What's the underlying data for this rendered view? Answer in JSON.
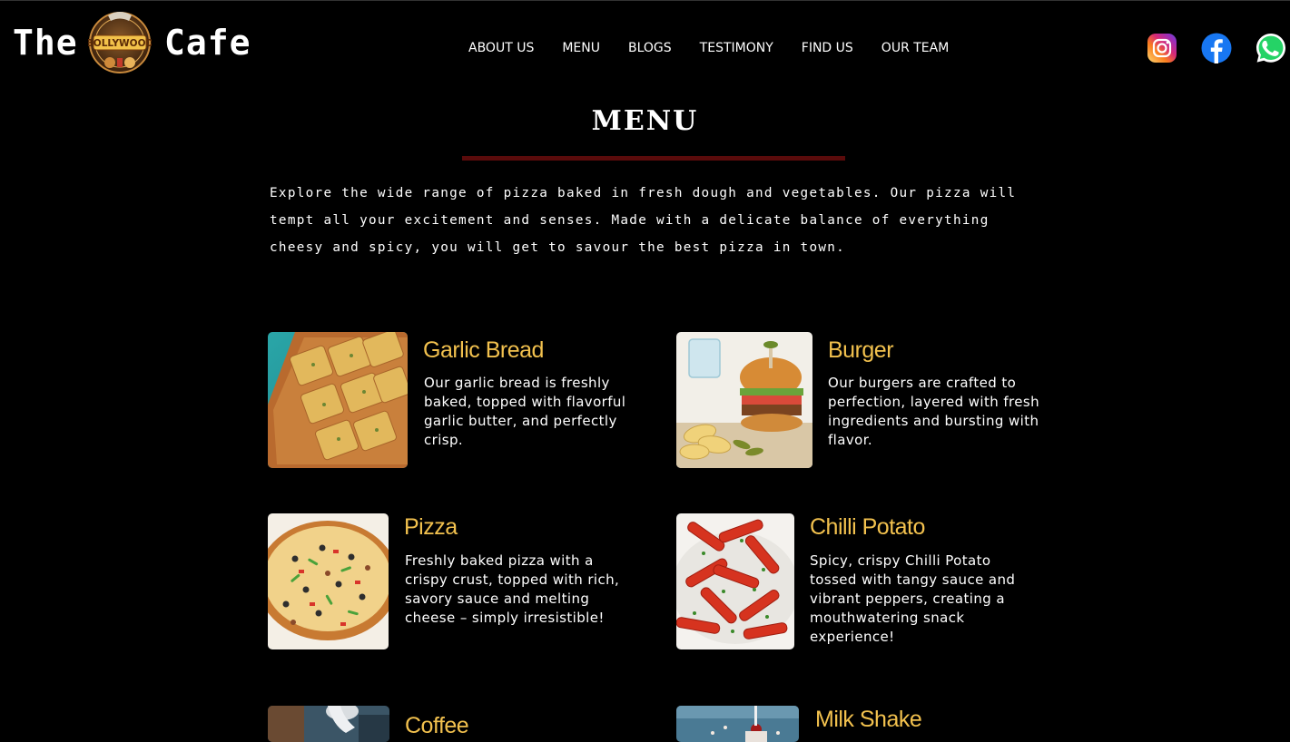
{
  "header": {
    "brand_left": "The",
    "brand_right": "Cafe",
    "logo_text": "BOLLYWOOD",
    "nav": [
      "ABOUT US",
      "MENU",
      "BLOGS",
      "TESTIMONY",
      "FIND US",
      "OUR TEAM"
    ],
    "social": [
      "instagram-icon",
      "facebook-icon",
      "whatsapp-icon"
    ]
  },
  "menu_section": {
    "title": "MENU",
    "intro": "Explore the wide range of pizza baked in fresh dough and vegetables. Our pizza will tempt all your excitement and senses. Made with a delicate balance of everything cheesy and spicy, you will get to savour the best pizza in town."
  },
  "items": [
    {
      "name": "Garlic Bread",
      "desc": "Our garlic bread is freshly baked, topped with flavorful garlic butter, and perfectly crisp."
    },
    {
      "name": "Burger",
      "desc": "Our burgers are crafted to perfection, layered with fresh ingredients and bursting with flavor."
    },
    {
      "name": "Pizza",
      "desc": "Freshly baked pizza with a crispy crust, topped with rich, savory sauce and melting cheese – simply irresistible!"
    },
    {
      "name": "Chilli Potato",
      "desc": "Spicy, crispy Chilli Potato tossed with tangy sauce and vibrant peppers, creating a mouthwatering snack experience!"
    },
    {
      "name": "Coffee",
      "desc": ""
    },
    {
      "name": "Milk Shake",
      "desc": ""
    }
  ],
  "colors": {
    "background": "#000000",
    "item_title": "#f2c14e",
    "title_rule": "#5a0b0b"
  }
}
